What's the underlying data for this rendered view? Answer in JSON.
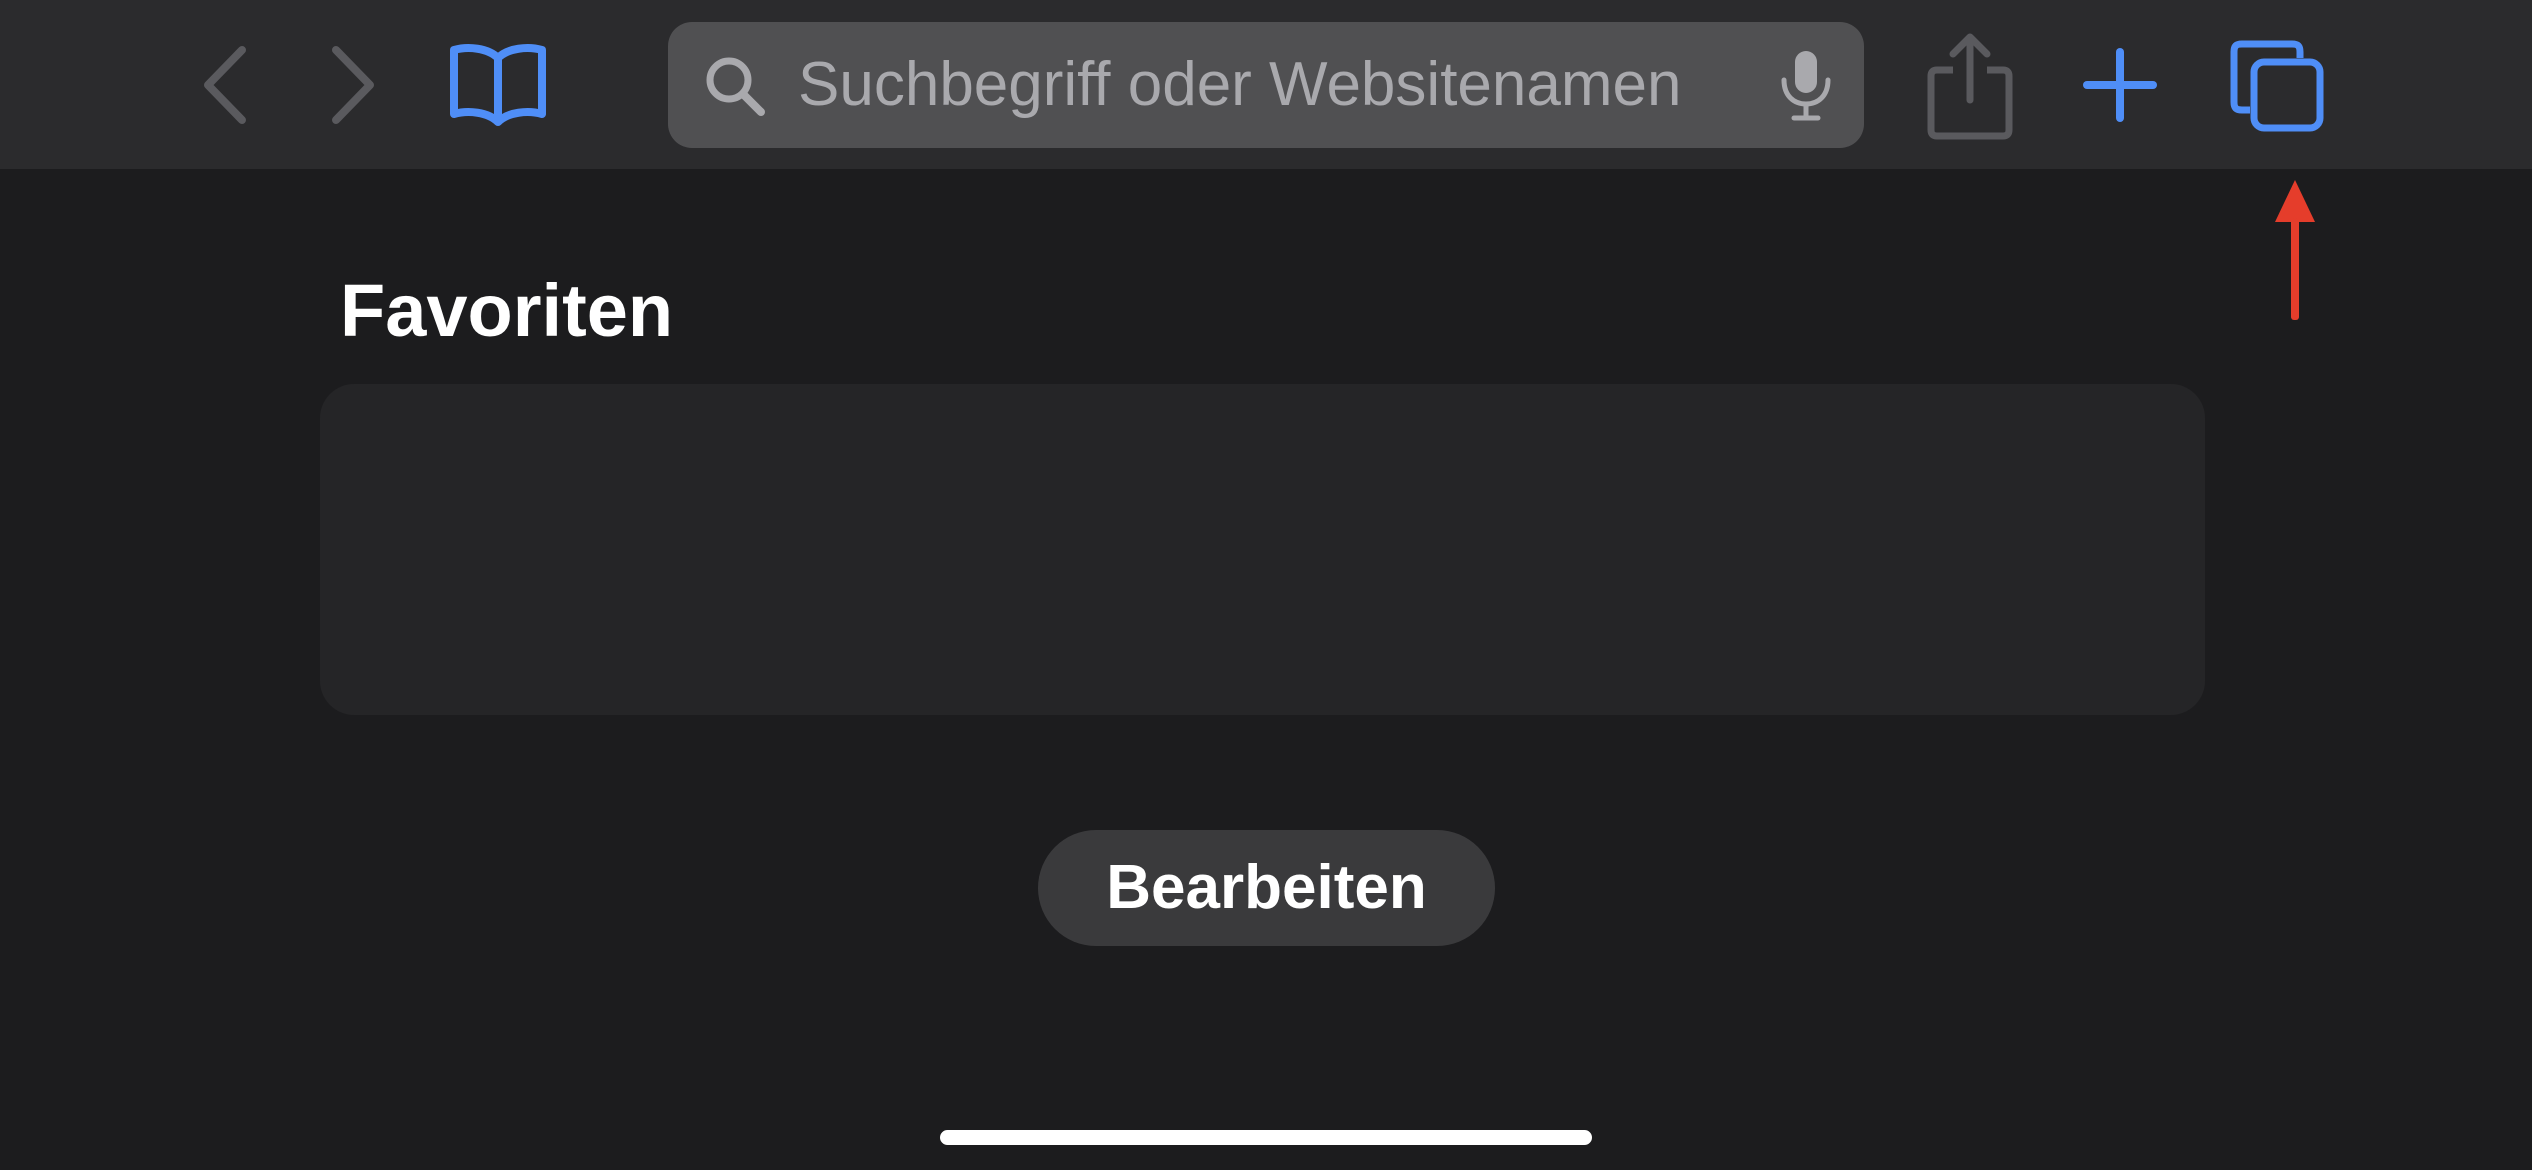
{
  "toolbar": {
    "search_placeholder": "Suchbegriff oder Websitenamen",
    "icons": {
      "back": "chevron-left-icon",
      "forward": "chevron-right-icon",
      "bookmarks": "book-icon",
      "search": "magnifier-icon",
      "mic": "microphone-icon",
      "share": "share-icon",
      "new_tab": "plus-icon",
      "tabs": "tabs-overview-icon"
    },
    "colors": {
      "accent": "#4f8ef7",
      "disabled": "#5a5a5e",
      "background": "#2b2b2d"
    }
  },
  "annotation": {
    "arrow_color": "#e53d2b",
    "points_to": "tabs-overview-button"
  },
  "main": {
    "favorites_title": "Favoriten",
    "edit_label": "Bearbeiten"
  }
}
